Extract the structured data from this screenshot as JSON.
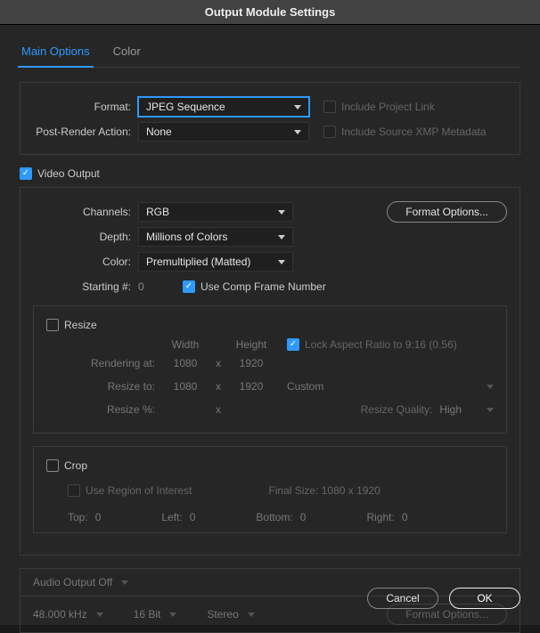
{
  "title": "Output Module Settings",
  "tabs": {
    "main": "Main Options",
    "color": "Color"
  },
  "top": {
    "format_label": "Format:",
    "format_value": "JPEG Sequence",
    "post_render_label": "Post-Render Action:",
    "post_render_value": "None",
    "include_project_link": "Include Project Link",
    "include_xmp": "Include Source XMP Metadata"
  },
  "video": {
    "output_label": "Video Output",
    "channels_label": "Channels:",
    "channels_value": "RGB",
    "depth_label": "Depth:",
    "depth_value": "Millions of Colors",
    "color_label": "Color:",
    "color_value": "Premultiplied (Matted)",
    "starting_label": "Starting #:",
    "starting_value": "0",
    "use_comp_frame": "Use Comp Frame Number",
    "format_options_btn": "Format Options..."
  },
  "resize": {
    "label": "Resize",
    "width_col": "Width",
    "height_col": "Height",
    "lock_aspect": "Lock Aspect Ratio to 9:16 (0.56)",
    "rendering_at": "Rendering at:",
    "w": "1080",
    "h": "1920",
    "resize_to": "Resize to:",
    "rw": "1080",
    "rh": "1920",
    "preset": "Custom",
    "resize_pct": "Resize %:",
    "quality_label": "Resize Quality:",
    "quality_value": "High",
    "x_sep": "x"
  },
  "crop": {
    "label": "Crop",
    "use_roi": "Use Region of Interest",
    "final_size": "Final Size: 1080 x 1920",
    "top_l": "Top:",
    "top_v": "0",
    "left_l": "Left:",
    "left_v": "0",
    "bottom_l": "Bottom:",
    "bottom_v": "0",
    "right_l": "Right:",
    "right_v": "0"
  },
  "audio": {
    "output_label": "Audio Output Off",
    "sample_rate": "48.000 kHz",
    "bit_depth": "16 Bit",
    "channels": "Stereo",
    "format_options": "Format Options..."
  },
  "buttons": {
    "cancel": "Cancel",
    "ok": "OK"
  }
}
